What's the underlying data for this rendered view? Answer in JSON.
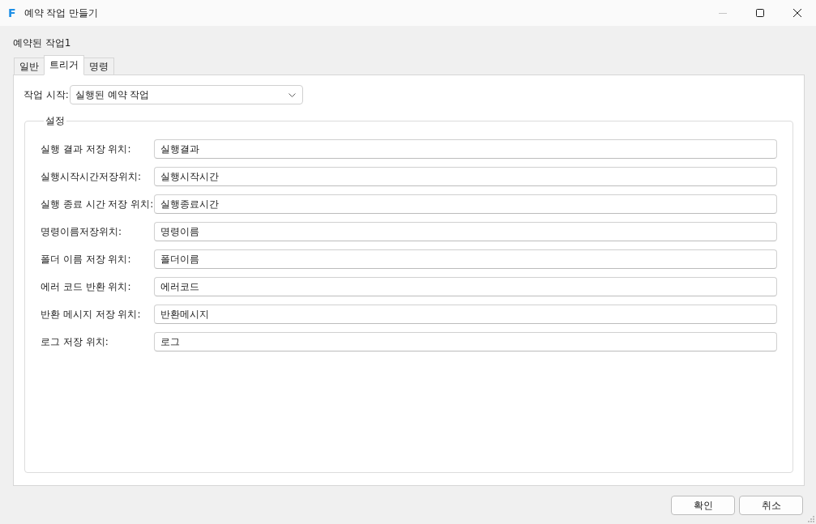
{
  "window": {
    "logo": "F",
    "title": "예약 작업 만들기",
    "controls": [
      {
        "kind": "minimize",
        "disabled": true
      },
      {
        "kind": "maximize",
        "disabled": false
      },
      {
        "kind": "close",
        "disabled": false
      }
    ]
  },
  "task_name": "예약된 작업1",
  "tabs": [
    {
      "label": "일반",
      "selected": false
    },
    {
      "label": "트리거",
      "selected": true
    },
    {
      "label": "명령",
      "selected": false
    }
  ],
  "trigger": {
    "label": "작업 시작:",
    "value": "실행된 예약 작업"
  },
  "settings": {
    "title": "설정",
    "fields": [
      {
        "label": "실행 결과 저장 위치:",
        "value": "실행결과"
      },
      {
        "label": "실행시작시간저장위치:",
        "value": "실행시작시간"
      },
      {
        "label": "실행 종료 시간 저장 위치:",
        "value": "실행종료시간"
      },
      {
        "label": "명령이름저장위치:",
        "value": "명령이름"
      },
      {
        "label": "폴더 이름 저장 위치:",
        "value": "폴더이름"
      },
      {
        "label": "에러 코드 반환 위치:",
        "value": "에러코드"
      },
      {
        "label": "반환 메시지 저장 위치:",
        "value": "반환메시지"
      },
      {
        "label": "로그 저장 위치:",
        "value": "로그"
      }
    ]
  },
  "buttons": [
    "확인",
    "취소"
  ]
}
